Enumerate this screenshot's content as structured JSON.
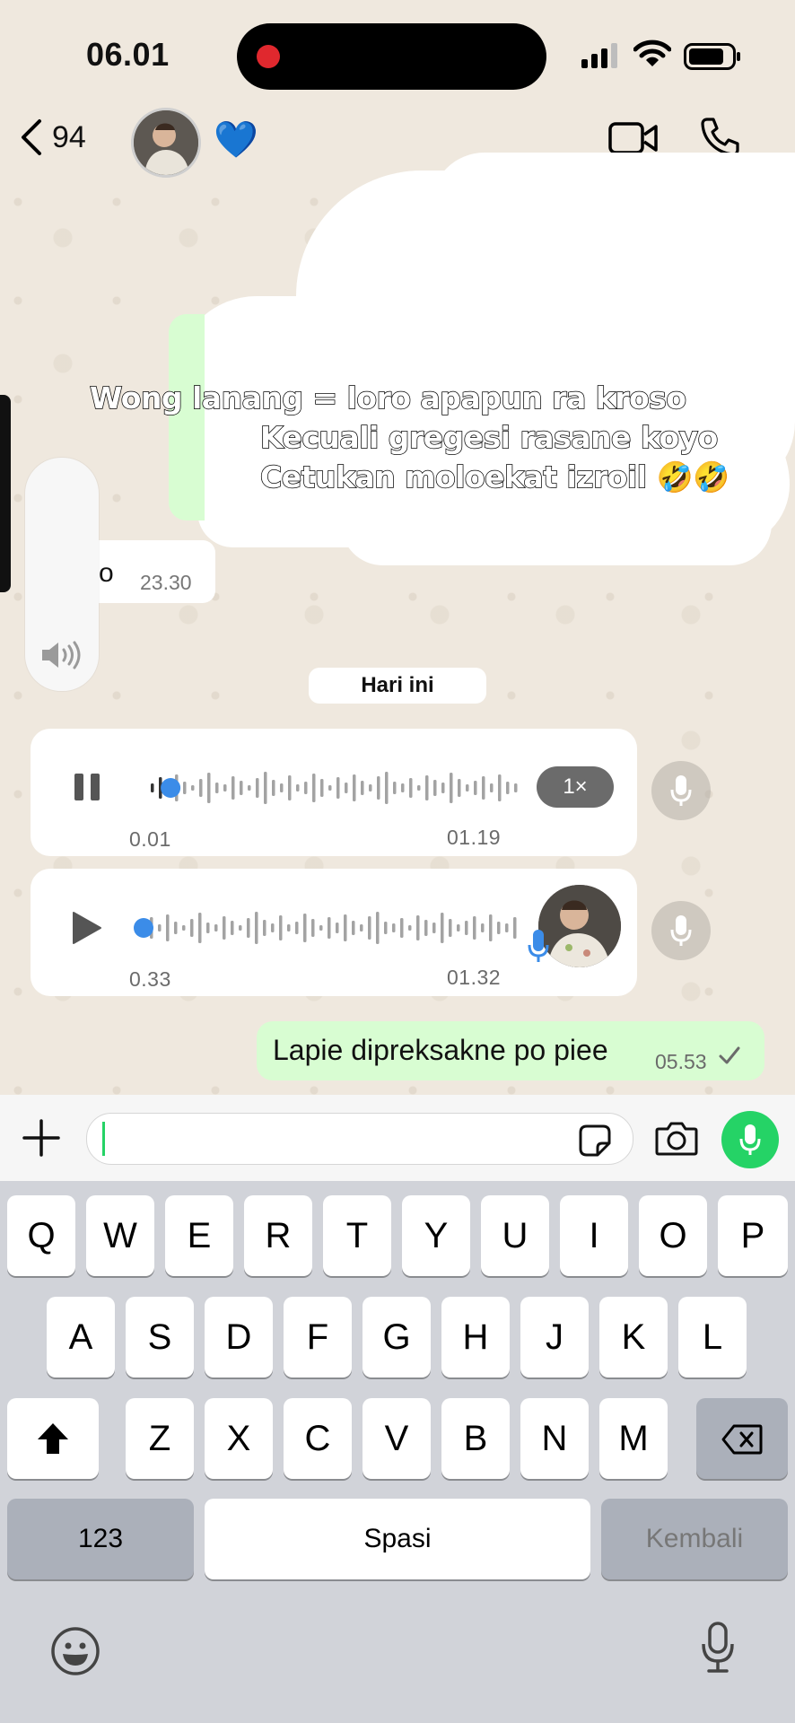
{
  "status_bar": {
    "time": "06.01"
  },
  "header": {
    "back_count": "94",
    "emoji": "💙",
    "icons": [
      "back-chevron-icon",
      "video-call-icon",
      "phone-call-icon"
    ]
  },
  "overlay_text": {
    "line1": "Wong lanang = loro apapun ra kroso",
    "line2": "Kecuali gregesi rasane koyo",
    "line3": "Cetukan moloekat izroil 🤣🤣"
  },
  "old_message": {
    "text": "o",
    "time": "23.30"
  },
  "date_chip": "Hari ini",
  "voice_messages": [
    {
      "elapsed": "0.01",
      "duration": "01.19",
      "speed": "1×",
      "state": "playing",
      "progress": 0.01
    },
    {
      "elapsed": "0.33",
      "duration": "01.32",
      "state": "paused",
      "progress": 0.0
    }
  ],
  "outgoing": {
    "text": "Lapie dipreksakne po piee",
    "time": "05.53"
  },
  "composer": {
    "placeholder": ""
  },
  "keyboard": {
    "row1": [
      "Q",
      "W",
      "E",
      "R",
      "T",
      "Y",
      "U",
      "I",
      "O",
      "P"
    ],
    "row2": [
      "A",
      "S",
      "D",
      "F",
      "G",
      "H",
      "J",
      "K",
      "L"
    ],
    "row3": [
      "Z",
      "X",
      "C",
      "V",
      "B",
      "N",
      "M"
    ],
    "numbers": "123",
    "space": "Spasi",
    "return": "Kembali"
  },
  "colors": {
    "accent_green": "#25d366",
    "outgoing_bubble": "#d8fdd2",
    "wallpaper": "#efe8de"
  }
}
